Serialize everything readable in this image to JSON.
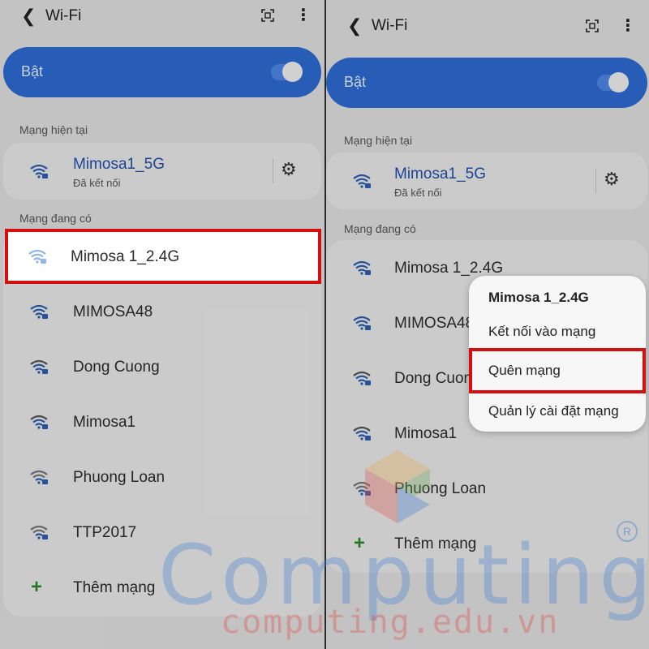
{
  "left": {
    "header": {
      "title": "Wi-Fi"
    },
    "wifi_toggle": {
      "label": "Bật",
      "on": true
    },
    "current_section": "Mạng hiện tại",
    "current_network": {
      "name": "Mimosa1_5G",
      "status": "Đã kết nối"
    },
    "available_section": "Mạng đang có",
    "networks": [
      {
        "name": "Mimosa 1_2.4G"
      },
      {
        "name": "MIMOSA48"
      },
      {
        "name": "Dong Cuong"
      },
      {
        "name": "Mimosa1"
      },
      {
        "name": "Phuong Loan"
      },
      {
        "name": "TTP2017"
      }
    ],
    "add_network": "Thêm mạng"
  },
  "right": {
    "header": {
      "title": "Wi-Fi"
    },
    "wifi_toggle": {
      "label": "Bật",
      "on": true
    },
    "current_section": "Mạng hiện tại",
    "current_network": {
      "name": "Mimosa1_5G",
      "status": "Đã kết nối"
    },
    "available_section": "Mạng đang có",
    "networks": [
      {
        "name": "Mimosa 1_2.4G"
      },
      {
        "name": "MIMOSA48"
      },
      {
        "name": "Dong Cuon"
      },
      {
        "name": "Mimosa1"
      },
      {
        "name": "Phuong Loan"
      }
    ],
    "add_network": "Thêm mạng",
    "context_menu": {
      "title": "Mimosa 1_2.4G",
      "items": [
        "Kết nối vào mạng",
        "Quên mạng",
        "Quản lý cài đặt mạng"
      ]
    }
  },
  "watermark": {
    "text": "Computing",
    "url": "computing.edu.vn",
    "registered": "R"
  },
  "colors": {
    "accent": "#2d6bd1",
    "highlight": "#d40f0f",
    "link": "#1f4fa8"
  }
}
